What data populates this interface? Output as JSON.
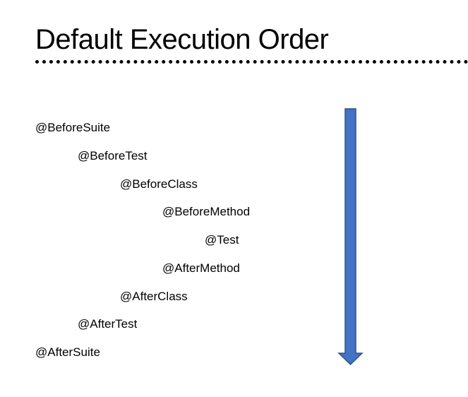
{
  "title": "Default Execution Order",
  "colors": {
    "arrow_fill": "#4472C4",
    "arrow_stroke": "#2F528F"
  },
  "steps": [
    {
      "label": "@BeforeSuite",
      "indent_level": 0
    },
    {
      "label": "@BeforeTest",
      "indent_level": 1
    },
    {
      "label": "@BeforeClass",
      "indent_level": 2
    },
    {
      "label": "@BeforeMethod",
      "indent_level": 3
    },
    {
      "label": "@Test",
      "indent_level": 4
    },
    {
      "label": "@AfterMethod",
      "indent_level": 3
    },
    {
      "label": "@AfterClass",
      "indent_level": 2
    },
    {
      "label": "@AfterTest",
      "indent_level": 1
    },
    {
      "label": "@AfterSuite",
      "indent_level": 0
    }
  ]
}
